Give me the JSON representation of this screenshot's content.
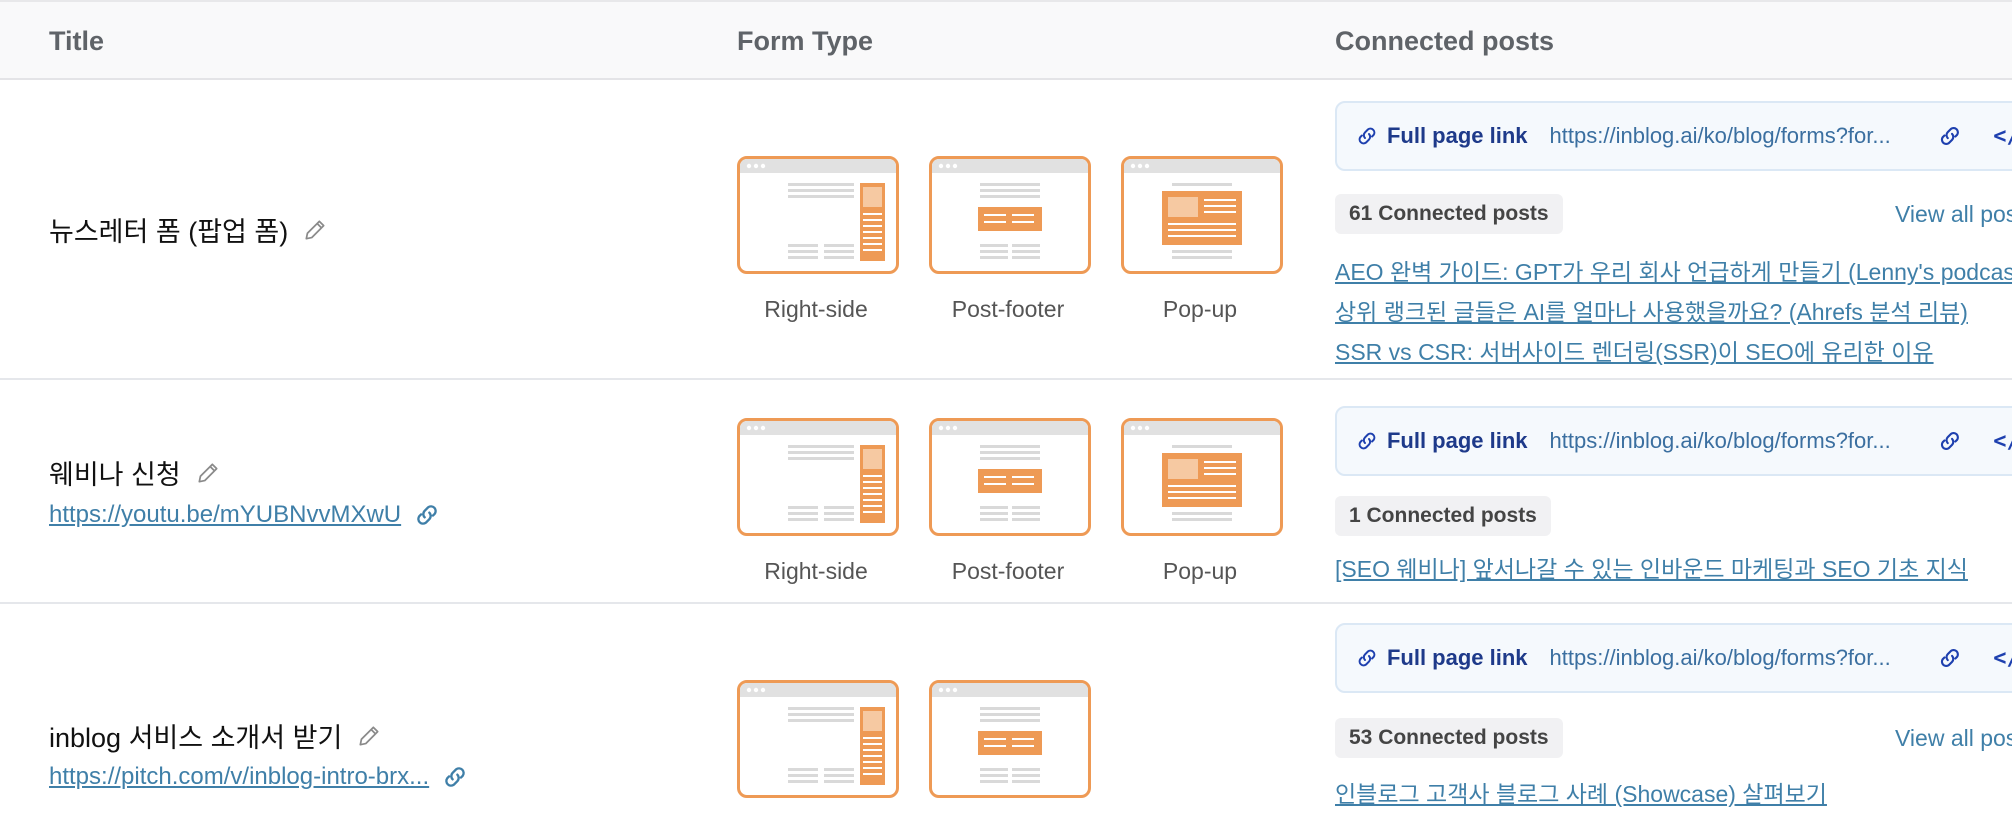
{
  "header": {
    "col_title": "Title",
    "col_form_type": "Form Type",
    "col_connected": "Connected posts"
  },
  "rows": [
    {
      "title": "뉴스레터 폼 (팝업 폼)",
      "link": "",
      "form_types": [
        "Right-side",
        "Post-footer",
        "Pop-up"
      ],
      "full_page_label": "Full page link",
      "full_page_url": "https://inblog.ai/ko/blog/forms?for...",
      "connected_count": "61 Connected posts",
      "view_all": "View all posts",
      "posts": [
        "AEO 완벽 가이드: GPT가 우리 회사 언급하게 만들기 (Lenny's podcast",
        "상위 랭크된 글들은 AI를 얼마나 사용했을까요? (Ahrefs 분석 리뷰)",
        "SSR vs CSR: 서버사이드 렌더링(SSR)이 SEO에 유리한 이유"
      ]
    },
    {
      "title": "웨비나 신청",
      "link": "https://youtu.be/mYUBNvvMXwU",
      "form_types": [
        "Right-side",
        "Post-footer",
        "Pop-up"
      ],
      "full_page_label": "Full page link",
      "full_page_url": "https://inblog.ai/ko/blog/forms?for...",
      "connected_count": "1 Connected posts",
      "posts": [
        "[SEO 웨비나] 앞서나갈 수 있는 인바운드 마케팅과 SEO 기초 지식"
      ]
    },
    {
      "title": "inblog 서비스 소개서 받기",
      "link": "https://pitch.com/v/inblog-intro-brx...",
      "form_types": [
        "Right-side",
        "Post-footer"
      ],
      "full_page_label": "Full page link",
      "full_page_url": "https://inblog.ai/ko/blog/forms?for...",
      "connected_count": "53 Connected posts",
      "view_all": "View all posts",
      "posts": [
        "인블로그 고객사 블로그 사례 (Showcase) 살펴보기"
      ]
    }
  ],
  "icons": {
    "edit": "pencil-icon",
    "link": "link-icon",
    "copy": "copy-link-icon",
    "embed": "embed-code-icon"
  },
  "colors": {
    "accent_orange": "#ee9a55",
    "link_blue": "#3f7fa8",
    "label_navy": "#1e3a8a"
  }
}
